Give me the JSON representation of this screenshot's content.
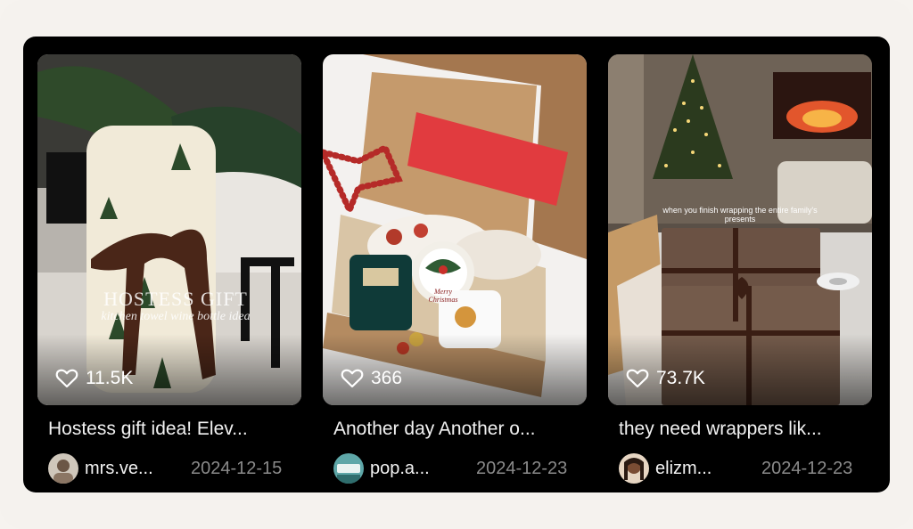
{
  "cards": [
    {
      "likes": "11.5K",
      "title": "Hostess gift idea! Elev...",
      "author": "mrs.ve...",
      "date": "2024-12-15",
      "overlay_title": "HOSTESS GIFT",
      "overlay_subtitle": "kitchen towel wine bottle idea"
    },
    {
      "likes": "366",
      "title": "Another day Another o...",
      "author": "pop.a...",
      "date": "2024-12-23",
      "mug_text": "Merry Christmas"
    },
    {
      "likes": "73.7K",
      "title": "they need wrappers lik...",
      "author": "elizm...",
      "date": "2024-12-23",
      "caption_line1": "when you finish wrapping the entire family's",
      "caption_line2": "presents"
    }
  ],
  "icons": {
    "likes": "heart-outline-icon"
  },
  "colors": {
    "panel": "#000000",
    "title": "#f2f2f2",
    "date": "#8a8a8a",
    "background": "#f5f2ee"
  }
}
